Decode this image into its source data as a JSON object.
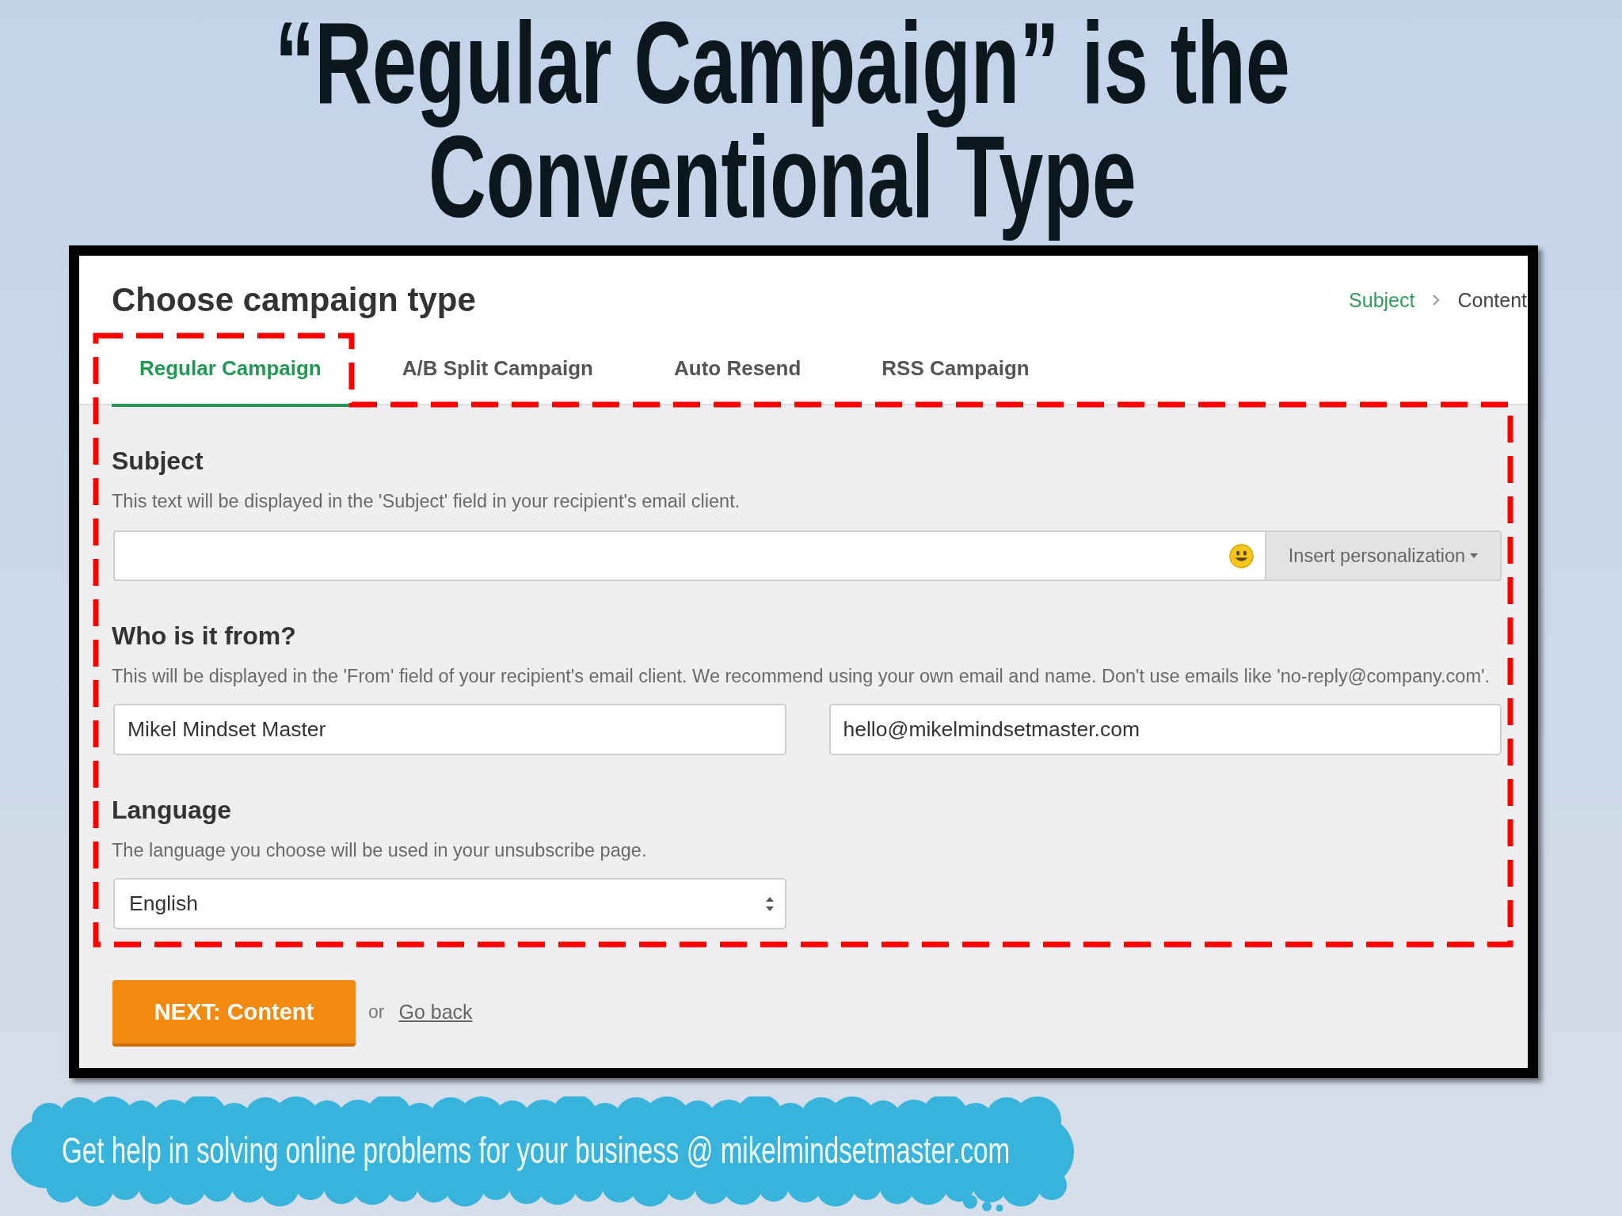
{
  "slide_title": [
    "“Regular Campaign” is the",
    "Conventional Type"
  ],
  "panel": {
    "heading": "Choose campaign type",
    "breadcrumb": [
      {
        "label": "Subject",
        "active": true
      },
      {
        "label": "Content",
        "active": false
      }
    ],
    "tabs": [
      {
        "label": "Regular Campaign",
        "selected": true
      },
      {
        "label": "A/B Split Campaign",
        "selected": false
      },
      {
        "label": "Auto Resend",
        "selected": false
      },
      {
        "label": "RSS Campaign",
        "selected": false
      }
    ],
    "subject": {
      "heading": "Subject",
      "description": "This text will be displayed in the 'Subject' field in your recipient's email client.",
      "personalization_button": "Insert personalization"
    },
    "sender": {
      "heading": "Who is it from?",
      "description": "This will be displayed in the 'From' field of your recipient's email client. We recommend using your own email and name. Don't use emails like 'no-reply@company.com'.",
      "name_value": "Mikel Mindset Master",
      "email_value": "hello@mikelmindsetmaster.com"
    },
    "language": {
      "heading": "Language",
      "description": "The language you choose will be used in your unsubscribe page.",
      "value": "English"
    },
    "next_button": "NEXT: Content",
    "or_text": "or",
    "back_link": "Go back"
  },
  "banner": {
    "text": "Get help in solving online problems for your business @ mikelmindsetmaster.com"
  }
}
